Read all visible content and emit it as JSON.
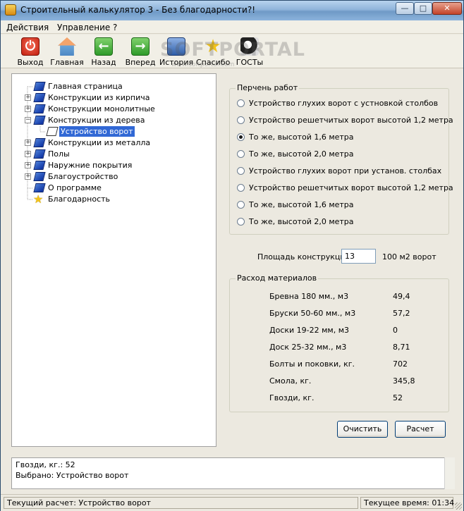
{
  "window": {
    "title": "Строительный калькулятор 3 - Без благодарности?!",
    "min_glyph": "—",
    "max_glyph": "□",
    "close_glyph": "✕"
  },
  "menu": [
    "Действия",
    "Управление",
    "?"
  ],
  "toolbar": {
    "items": [
      {
        "label": "Выход",
        "icon": "exit-icon"
      },
      {
        "label": "Главная",
        "icon": "home-icon"
      },
      {
        "label": "Назад",
        "icon": "back-arrow-icon"
      },
      {
        "label": "Вперед",
        "icon": "forward-arrow-icon"
      },
      {
        "label": "История",
        "icon": "history-icon"
      },
      {
        "label": "Спасибо",
        "icon": "star-icon"
      },
      {
        "label": "ГОСТы",
        "icon": "gost-icon"
      }
    ],
    "watermark": "SOFTPORTAL",
    "watermark_url": "www.softportal.com"
  },
  "tree": [
    {
      "label": "Главная страница",
      "expander": "",
      "icon": "book-icon"
    },
    {
      "label": "Конструкции из кирпича",
      "expander": "+",
      "icon": "book-icon"
    },
    {
      "label": "Конструкции монолитные",
      "expander": "+",
      "icon": "book-icon"
    },
    {
      "label": "Конструкции из дерева",
      "expander": "−",
      "icon": "book-icon"
    },
    {
      "label": "Устройство ворот",
      "expander": "",
      "icon": "open-book-icon",
      "selected": true
    },
    {
      "label": "Конструкции из металла",
      "expander": "+",
      "icon": "book-icon"
    },
    {
      "label": "Полы",
      "expander": "+",
      "icon": "book-icon"
    },
    {
      "label": "Наружние покрытия",
      "expander": "+",
      "icon": "book-icon"
    },
    {
      "label": "Благоустройство",
      "expander": "+",
      "icon": "book-icon"
    },
    {
      "label": "О программе",
      "expander": "",
      "icon": "book-icon"
    },
    {
      "label": "Благодарность",
      "expander": "",
      "icon": "star-icon"
    }
  ],
  "works": {
    "title": "Перчень работ",
    "options": [
      "Устройство глухих ворот с устновкой столбов",
      "Устройство решетчитых ворот высотой 1,2 метра",
      "То же, высотой 1,6 метра",
      "То же, высотой 2,0 метра",
      "Устройство глухих ворот при установ. столбах",
      "Устройство решетчитых ворот высотой 1,2 метра",
      "То же, высотой 1,6 метра",
      "То же, высотой 2,0 метра"
    ],
    "selected_index": 2
  },
  "area": {
    "label": "Площадь конструкций",
    "value": "13",
    "unit": "100 м2 ворот"
  },
  "materials": {
    "title": "Расход материалов",
    "rows": [
      {
        "name": "Бревна 180 мм., м3",
        "value": "49,4"
      },
      {
        "name": "Бруски 50-60 мм., м3",
        "value": "57,2"
      },
      {
        "name": "Доски 19-22 мм, м3",
        "value": "0"
      },
      {
        "name": "Доск 25-32 мм., м3",
        "value": "8,71"
      },
      {
        "name": "Болты и поковки, кг.",
        "value": "702"
      },
      {
        "name": "Смола, кг.",
        "value": "345,8"
      },
      {
        "name": "Гвозди, кг.",
        "value": "52"
      }
    ]
  },
  "buttons": {
    "clear": "Очистить",
    "calc": "Расчет"
  },
  "log": {
    "lines": [
      "Гвозди, кг.: 52",
      "Выбрано:  Устройство ворот"
    ]
  },
  "status": {
    "current_calc": "Текущий расчет: Устройство ворот",
    "current_time": "Текущее время: 01:34"
  }
}
